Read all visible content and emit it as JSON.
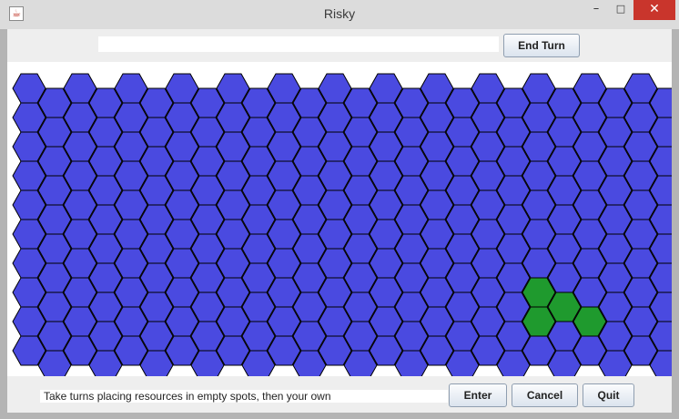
{
  "window": {
    "title": "Risky",
    "app_icon": "java-icon",
    "controls": {
      "minimize": "–",
      "maximize": "□",
      "close": "✕"
    }
  },
  "toolbar": {
    "input_value": "",
    "end_turn_label": "End Turn"
  },
  "board": {
    "columns": 26,
    "rows": 10,
    "colors": {
      "empty": "#4a4ae0",
      "owned": "#1f9a2e",
      "outline": "#000000"
    },
    "owned_cells": [
      {
        "col": 20,
        "row": 7
      },
      {
        "col": 21,
        "row": 7
      },
      {
        "col": 20,
        "row": 8
      },
      {
        "col": 22,
        "row": 8
      }
    ]
  },
  "footer": {
    "status_text": "Take turns placing resources in empty spots, then your own",
    "enter_label": "Enter",
    "cancel_label": "Cancel",
    "quit_label": "Quit"
  }
}
